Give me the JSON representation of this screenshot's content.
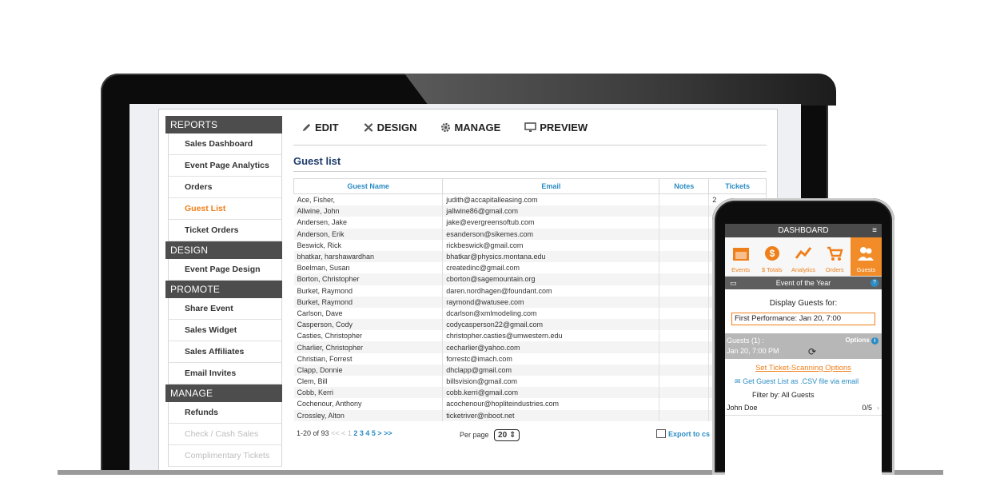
{
  "sidebar": {
    "sections": [
      {
        "header": "REPORTS",
        "items": [
          {
            "label": "Sales Dashboard",
            "state": "normal"
          },
          {
            "label": "Event Page Analytics",
            "state": "normal"
          },
          {
            "label": "Orders",
            "state": "normal"
          },
          {
            "label": "Guest List",
            "state": "active"
          },
          {
            "label": "Ticket Orders",
            "state": "normal"
          }
        ]
      },
      {
        "header": "DESIGN",
        "items": [
          {
            "label": "Event Page Design",
            "state": "normal"
          }
        ]
      },
      {
        "header": "PROMOTE",
        "items": [
          {
            "label": "Share Event",
            "state": "normal"
          },
          {
            "label": "Sales Widget",
            "state": "normal"
          },
          {
            "label": "Sales Affiliates",
            "state": "normal"
          },
          {
            "label": "Email Invites",
            "state": "normal"
          }
        ]
      },
      {
        "header": "MANAGE",
        "items": [
          {
            "label": "Refunds",
            "state": "normal"
          },
          {
            "label": "Check / Cash Sales",
            "state": "disabled"
          },
          {
            "label": "Complimentary Tickets",
            "state": "disabled"
          }
        ]
      }
    ]
  },
  "toolbar": {
    "edit": "EDIT",
    "design": "DESIGN",
    "manage": "MANAGE",
    "preview": "PREVIEW"
  },
  "guest_list": {
    "title": "Guest list",
    "columns": [
      "Guest Name",
      "Email",
      "Notes",
      "Tickets"
    ],
    "rows": [
      [
        "Ace, Fisher,",
        "judith@accapitalleasing.com",
        "",
        "2"
      ],
      [
        "Allwine, John",
        "jallwine86@gmail.com",
        "",
        ""
      ],
      [
        "Andersen, Jake",
        "jake@evergreensoftub.com",
        "",
        ""
      ],
      [
        "Anderson, Erik",
        "esanderson@sikemes.com",
        "",
        ""
      ],
      [
        "Beswick, Rick",
        "rickbeswick@gmail.com",
        "",
        ""
      ],
      [
        "bhatkar, harshawardhan",
        "bhatkar@physics.montana.edu",
        "",
        ""
      ],
      [
        "Boelman, Susan",
        "createdinc@gmail.com",
        "",
        ""
      ],
      [
        "Borton, Christopher",
        "cborton@sagemountain.org",
        "",
        ""
      ],
      [
        "Burket, Raymond",
        "daren.nordhagen@foundant.com",
        "",
        ""
      ],
      [
        "Burket, Raymond",
        "raymond@watusee.com",
        "",
        ""
      ],
      [
        "Carlson, Dave",
        "dcarlson@xmlmodeling.com",
        "",
        ""
      ],
      [
        "Casperson, Cody",
        "codycasperson22@gmail.com",
        "",
        ""
      ],
      [
        "Casties, Christopher",
        "christopher.casties@umwestern.edu",
        "",
        ""
      ],
      [
        "Charlier, Christopher",
        "cecharlier@yahoo.com",
        "",
        ""
      ],
      [
        "Christian, Forrest",
        "forrestc@imach.com",
        "",
        ""
      ],
      [
        "Clapp, Donnie",
        "dhclapp@gmail.com",
        "",
        ""
      ],
      [
        "Clem, Bill",
        "billsvision@gmail.com",
        "",
        ""
      ],
      [
        "Cobb, Kerri",
        "cobb.kerri@gmail.com",
        "",
        ""
      ],
      [
        "Cochenour, Anthony",
        "acochenour@hopliteindustries.com",
        "",
        ""
      ],
      [
        "Crossley, Alton",
        "ticketriver@nboot.net",
        "",
        ""
      ]
    ],
    "pager": {
      "range": "1-20 of 93",
      "prev": "<< < 1",
      "pages": "2 3 4 5 > >>",
      "per_page_label": "Per page",
      "per_page_value": "20",
      "export": "Export to cs"
    }
  },
  "phone": {
    "title": "DASHBOARD",
    "tabs": [
      {
        "label": "Events",
        "icon": "calendar-icon"
      },
      {
        "label": "$ Totals",
        "icon": "dollar-icon"
      },
      {
        "label": "Analytics",
        "icon": "chart-icon"
      },
      {
        "label": "Orders",
        "icon": "cart-icon"
      },
      {
        "label": "Guests",
        "icon": "guests-icon",
        "active": true
      }
    ],
    "event_name": "Event of the Year",
    "display_label": "Display Guests for:",
    "performance": "First Performance: Jan 20, 7:00",
    "guests_count": "Guests (1) :",
    "guests_date": "Jan 20, 7:00 PM",
    "options": "Options",
    "scan_link": "Set Ticket-Scanning Options",
    "csv_link": "Get Guest List as .CSV file via email",
    "filter": "Filter by:  All Guests",
    "guest_row": {
      "name": "John Doe",
      "count": "0/5"
    }
  },
  "colors": {
    "accent": "#ef7f1a",
    "link": "#2b8cc4",
    "title": "#1f3d6b",
    "sidebar_header": "#4d4d4d"
  }
}
